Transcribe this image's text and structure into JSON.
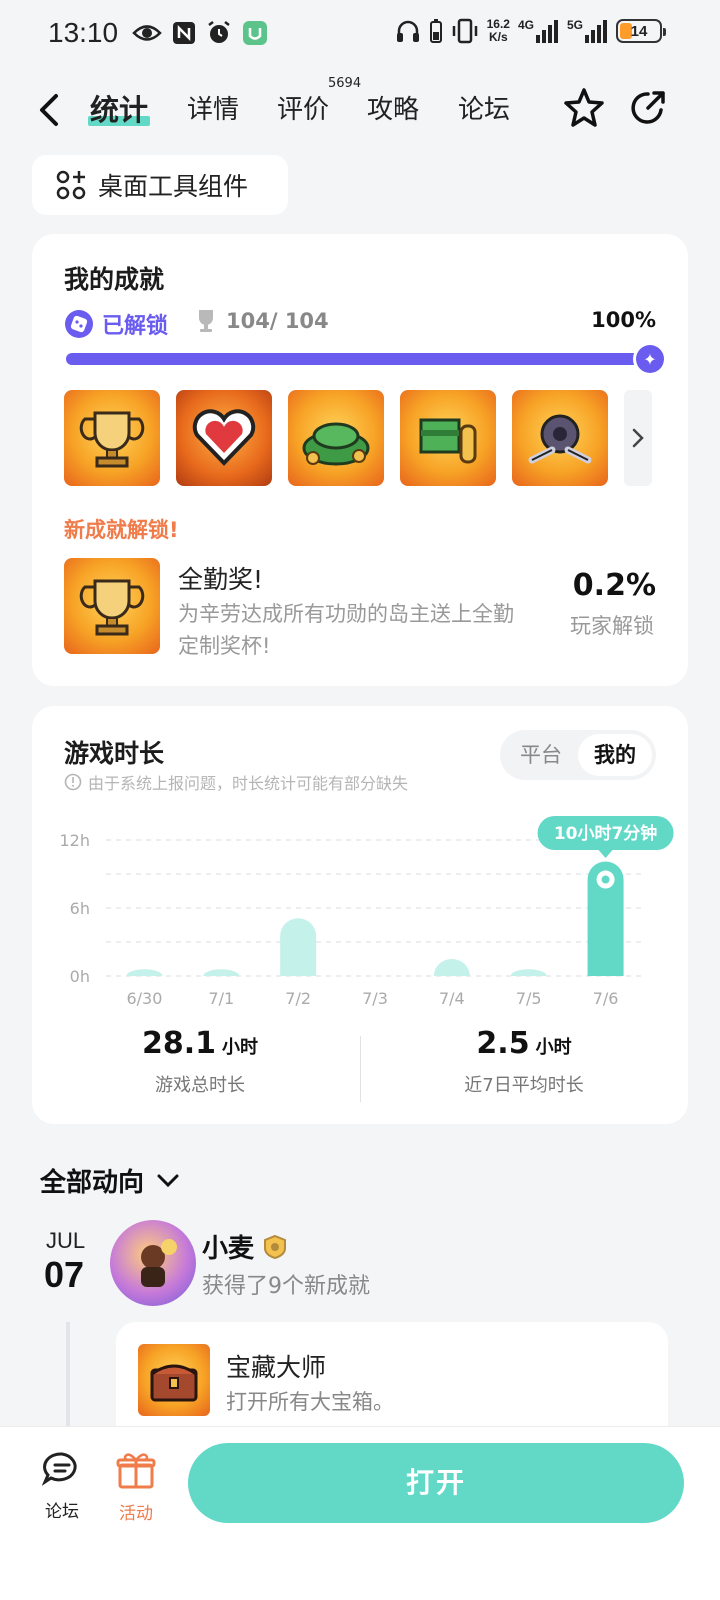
{
  "status_bar": {
    "time": "13:10",
    "net_speed_value": "16.2",
    "net_speed_unit": "K/s",
    "signal1": "4G",
    "signal2": "5G",
    "battery": "14"
  },
  "nav": {
    "tabs": [
      {
        "label": "统计",
        "active": true
      },
      {
        "label": "详情"
      },
      {
        "label": "评价",
        "badge": "5694"
      },
      {
        "label": "攻略"
      },
      {
        "label": "论坛"
      }
    ]
  },
  "widget_button": {
    "label": "桌面工具组件"
  },
  "achievements": {
    "title": "我的成就",
    "unlocked_label": "已解锁",
    "count": "104/ 104",
    "percent_text": "100%",
    "progress": 1.0,
    "badges": [
      "trophy-badge",
      "heart-badge",
      "cash-pile-badge",
      "money-coins-badge",
      "gear-wrench-badge"
    ],
    "new_unlock_title": "新成就解锁!",
    "new_unlock": {
      "name": "全勤奖!",
      "desc": "为辛劳达成所有功勋的岛主送上全勤定制奖杯!",
      "percent": "0.2%",
      "percent_label": "玩家解锁"
    }
  },
  "play_time": {
    "title": "游戏时长",
    "note": "由于系统上报问题，时长统计可能有部分缺失",
    "toggle": [
      "平台",
      "我的"
    ],
    "toggle_selected": 1,
    "tooltip": "10小时7分钟",
    "total_value": "28.1",
    "total_unit": "小时",
    "total_label": "游戏总时长",
    "avg_value": "2.5",
    "avg_unit": "小时",
    "avg_label": "近7日平均时长"
  },
  "chart_data": {
    "type": "bar",
    "categories": [
      "6/30",
      "7/1",
      "7/2",
      "7/3",
      "7/4",
      "7/5",
      "7/6"
    ],
    "values": [
      0.6,
      0.6,
      5.1,
      0,
      1.5,
      0.6,
      10.1
    ],
    "yticks": [
      "0h",
      "6h",
      "12h"
    ],
    "ylim": [
      0,
      12
    ],
    "grid": true,
    "highlight_index": 6,
    "bar_color": "#c4f1ea",
    "highlight_color": "#62d8c7"
  },
  "feed": {
    "title": "全部动向",
    "month": "JUL",
    "day": "07",
    "user": "小麦",
    "action": "获得了9个新成就",
    "item": {
      "name": "宝藏大师",
      "desc": "打开所有大宝箱。"
    }
  },
  "bottom_bar": {
    "forum_label": "论坛",
    "activity_label": "活动",
    "open_label": "打开"
  },
  "colors": {
    "accent": "#62d8c7",
    "purple": "#6b5cf0",
    "orange": "#ef7c4a"
  }
}
